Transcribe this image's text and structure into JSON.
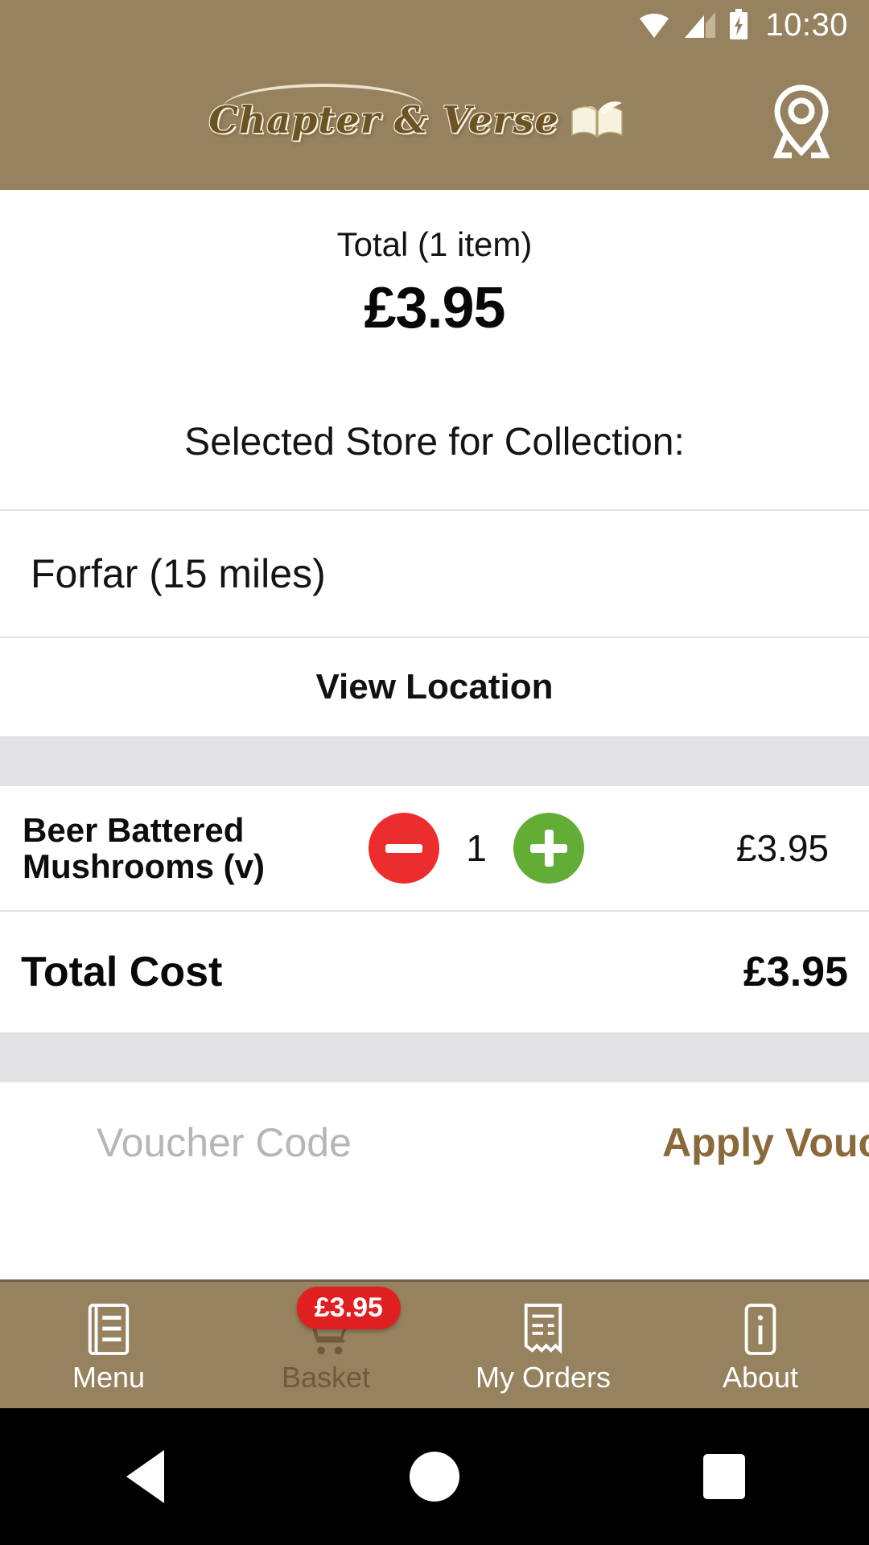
{
  "status_bar": {
    "time": "10:30",
    "wifi_icon": "wifi-icon",
    "signal_icon": "cellular-signal-icon",
    "battery_icon": "battery-charging-icon"
  },
  "header": {
    "logo_text": "Chapter & Verse",
    "book_icon": "open-book-quill-icon",
    "location_icon": "map-location-pin-icon",
    "background_color": "#97825f"
  },
  "summary": {
    "total_label": "Total (1 item)",
    "total_amount": "£3.95"
  },
  "store": {
    "heading": "Selected Store for Collection:",
    "selected": "Forfar (15 miles)",
    "view_location_label": "View Location"
  },
  "basket": {
    "items": [
      {
        "name": "Beer Battered Mushrooms (v)",
        "quantity": "1",
        "price": "£3.95",
        "decrease_icon": "minus-circle-icon",
        "increase_icon": "plus-circle-icon"
      }
    ],
    "total_cost_label": "Total Cost",
    "total_cost_value": "£3.95"
  },
  "voucher": {
    "placeholder": "Voucher Code",
    "value": "",
    "apply_label": "Apply Voucher"
  },
  "bottom_nav": {
    "items": [
      {
        "label": "Menu",
        "icon": "menu-list-icon",
        "active": false
      },
      {
        "label": "Basket",
        "icon": "shopping-cart-icon",
        "active": true,
        "badge": "£3.95"
      },
      {
        "label": "My Orders",
        "icon": "receipt-icon",
        "active": false
      },
      {
        "label": "About",
        "icon": "info-icon",
        "active": false
      }
    ]
  },
  "android_nav": {
    "back": "back-triangle-icon",
    "home": "home-circle-icon",
    "recents": "recents-square-icon"
  },
  "colors": {
    "brand_brown": "#97825f",
    "minus_red": "#ec2d2d",
    "plus_green": "#62ad36",
    "badge_red": "#e02020",
    "spacer_grey": "#e3e3e5"
  }
}
